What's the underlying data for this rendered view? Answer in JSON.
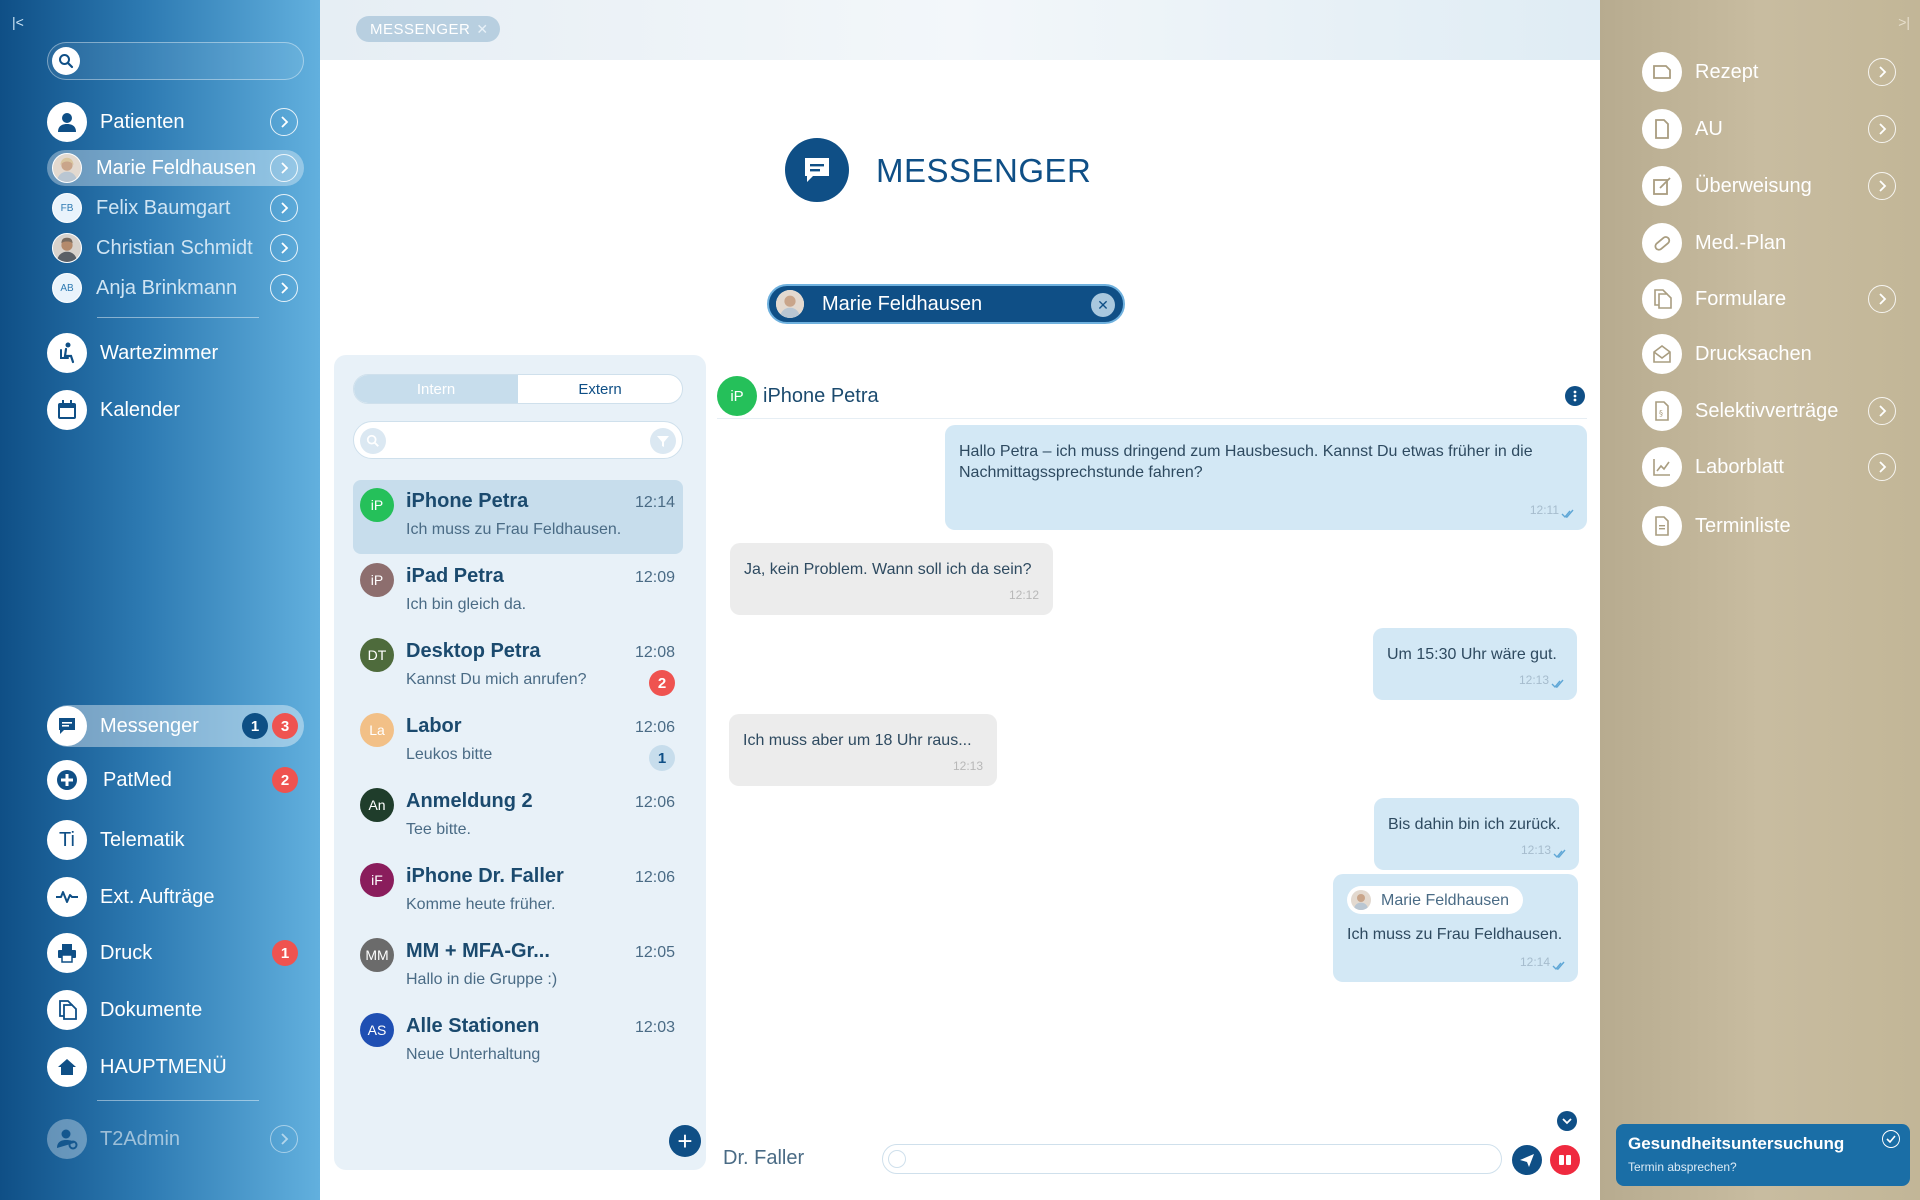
{
  "left_sidebar": {
    "patients_label": "Patienten",
    "patients": [
      {
        "name": "Marie Feldhausen",
        "initials": ""
      },
      {
        "name": "Felix Baumgart",
        "initials": "FB"
      },
      {
        "name": "Christian Schmidt",
        "initials": ""
      },
      {
        "name": "Anja Brinkmann",
        "initials": "AB"
      }
    ],
    "wartezimmer": "Wartezimmer",
    "kalender": "Kalender",
    "messenger": {
      "label": "Messenger",
      "badge_navy": "1",
      "badge_red": "3"
    },
    "patmed": {
      "label": "PatMed",
      "badge": "2"
    },
    "telematik": {
      "label": "Telematik",
      "icon_text": "Ti"
    },
    "ext_auftraege": "Ext. Aufträge",
    "druck": {
      "label": "Druck",
      "badge": "1"
    },
    "dokumente": "Dokumente",
    "hauptmenue": "HAUPTMENÜ",
    "user": "T2Admin"
  },
  "center": {
    "tab_label": "MESSENGER",
    "title": "MESSENGER",
    "selected_patient": "Marie Feldhausen",
    "segment": {
      "intern": "Intern",
      "extern": "Extern"
    },
    "contacts": [
      {
        "initials": "iP",
        "name": "iPhone Petra",
        "time": "12:14",
        "message": "Ich muss zu Frau Feldhausen.",
        "badge": "",
        "color": "#25c05a"
      },
      {
        "initials": "iP",
        "name": "iPad Petra",
        "time": "12:09",
        "message": "Ich bin gleich da.",
        "badge": "",
        "color": "#8d6e6e"
      },
      {
        "initials": "DT",
        "name": "Desktop Petra",
        "time": "12:08",
        "message": "Kannst Du mich anrufen?",
        "badge": "2",
        "color": "#4e6b3c"
      },
      {
        "initials": "La",
        "name": "Labor",
        "time": "12:06",
        "message": "Leukos bitte",
        "badge": "1",
        "color": "#f2c087"
      },
      {
        "initials": "An",
        "name": "Anmeldung 2",
        "time": "12:06",
        "message": "Tee bitte.",
        "badge": "",
        "color": "#1f3d2b"
      },
      {
        "initials": "iF",
        "name": "iPhone Dr. Faller",
        "time": "12:06",
        "message": "Komme heute früher.",
        "badge": "",
        "color": "#8a1d5c"
      },
      {
        "initials": "MM",
        "name": "MM + MFA-Gr...",
        "time": "12:05",
        "message": "Hallo in die Gruppe :)",
        "badge": "",
        "color": "#6b6b6b"
      },
      {
        "initials": "AS",
        "name": "Alle Stationen",
        "time": "12:03",
        "message": "Neue Unterhaltung",
        "badge": "",
        "color": "#1f4fb3"
      }
    ],
    "chat": {
      "contact_initials": "iP",
      "contact_name": "iPhone Petra",
      "messages": [
        {
          "text": "Hallo Petra – ich muss dringend zum Hausbesuch. Kannst Du etwas früher in die Nachmittagssprechstunde fahren?",
          "time": "12:11"
        },
        {
          "text": "Ja, kein Problem. Wann soll ich da sein?",
          "time": "12:12"
        },
        {
          "text": "Um 15:30 Uhr wäre gut.",
          "time": "12:13"
        },
        {
          "text": "Ich muss aber um 18 Uhr raus...",
          "time": "12:13"
        },
        {
          "text": "Bis dahin bin ich zurück.",
          "time": "12:13"
        },
        {
          "tag": "Marie Feldhausen",
          "text": "Ich muss zu Frau Feldhausen.",
          "time": "12:14"
        }
      ],
      "sender_label": "Dr. Faller"
    }
  },
  "right_sidebar": {
    "items": [
      "Rezept",
      "AU",
      "Überweisung",
      "Med.-Plan",
      "Formulare",
      "Drucksachen",
      "Selektivverträge",
      "Laborblatt",
      "Terminliste"
    ],
    "notification": {
      "title": "Gesundheitsuntersuchung",
      "subtitle": "Termin absprechen?"
    }
  },
  "colors": {
    "brand_navy": "#0f4f86",
    "badge_red": "#ef5350",
    "online_green": "#25c05a",
    "right_panel": "#c2b697"
  }
}
